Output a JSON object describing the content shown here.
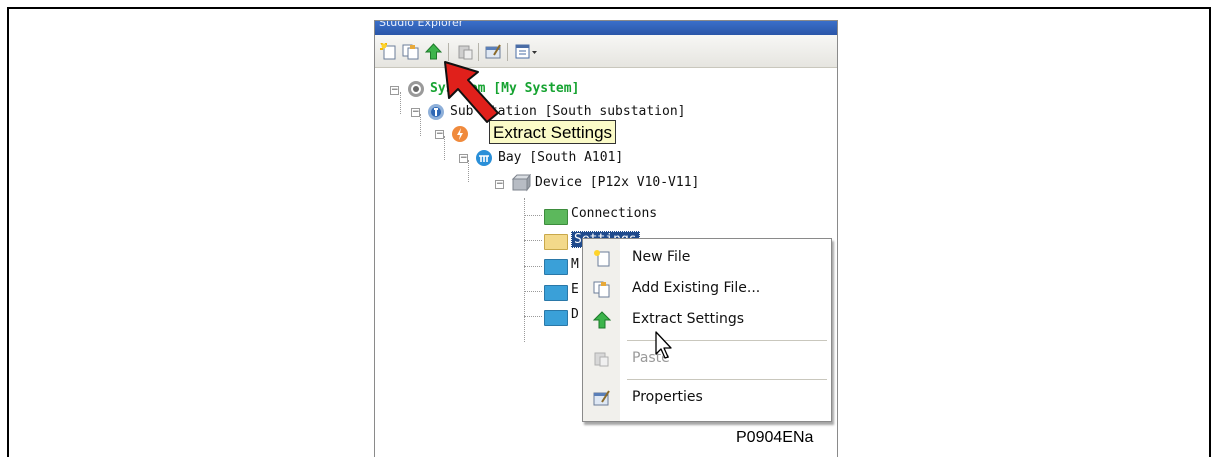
{
  "explorer": {
    "title": "Studio Explorer",
    "toolbar": {
      "buttons": [
        "new-file-icon",
        "add-existing-file-icon",
        "extract-settings-icon",
        "paste-icon",
        "properties-icon",
        "view-options-icon"
      ]
    },
    "tree": {
      "system": {
        "prefix": "Sys",
        "label": "tem [My System]"
      },
      "substation": {
        "prefix": "Sub",
        "label": "station [South substation]"
      },
      "voltage_icon": "voltage-level-icon",
      "bay": {
        "label": "Bay [South A101]"
      },
      "device": {
        "label": "Device [P12x V10-V11]"
      },
      "folders": [
        {
          "label": "Connections"
        },
        {
          "label": "Settings"
        },
        {
          "label": "M"
        },
        {
          "label": "E"
        },
        {
          "label": "D"
        }
      ]
    }
  },
  "tooltip": {
    "text": "Extract Settings"
  },
  "context_menu": {
    "items": [
      {
        "label": "New File",
        "icon": "new-file-icon",
        "enabled": true
      },
      {
        "label": "Add Existing File...",
        "icon": "add-existing-file-icon",
        "enabled": true
      },
      {
        "label": "Extract Settings",
        "icon": "extract-settings-icon",
        "enabled": true
      },
      {
        "label": "Paste",
        "icon": "paste-icon",
        "enabled": false
      },
      {
        "label": "Properties",
        "icon": "properties-icon",
        "enabled": true
      }
    ]
  },
  "caption": "P0904ENa",
  "colors": {
    "system_label": "#16a331",
    "selection": "#1f4a8c",
    "tooltip_bg": "#fbfbc8",
    "arrow": "#e0201b",
    "folder_green": "#5cb85c",
    "folder_blue": "#3aa0d8",
    "folder_yellow": "#f3d98a"
  }
}
